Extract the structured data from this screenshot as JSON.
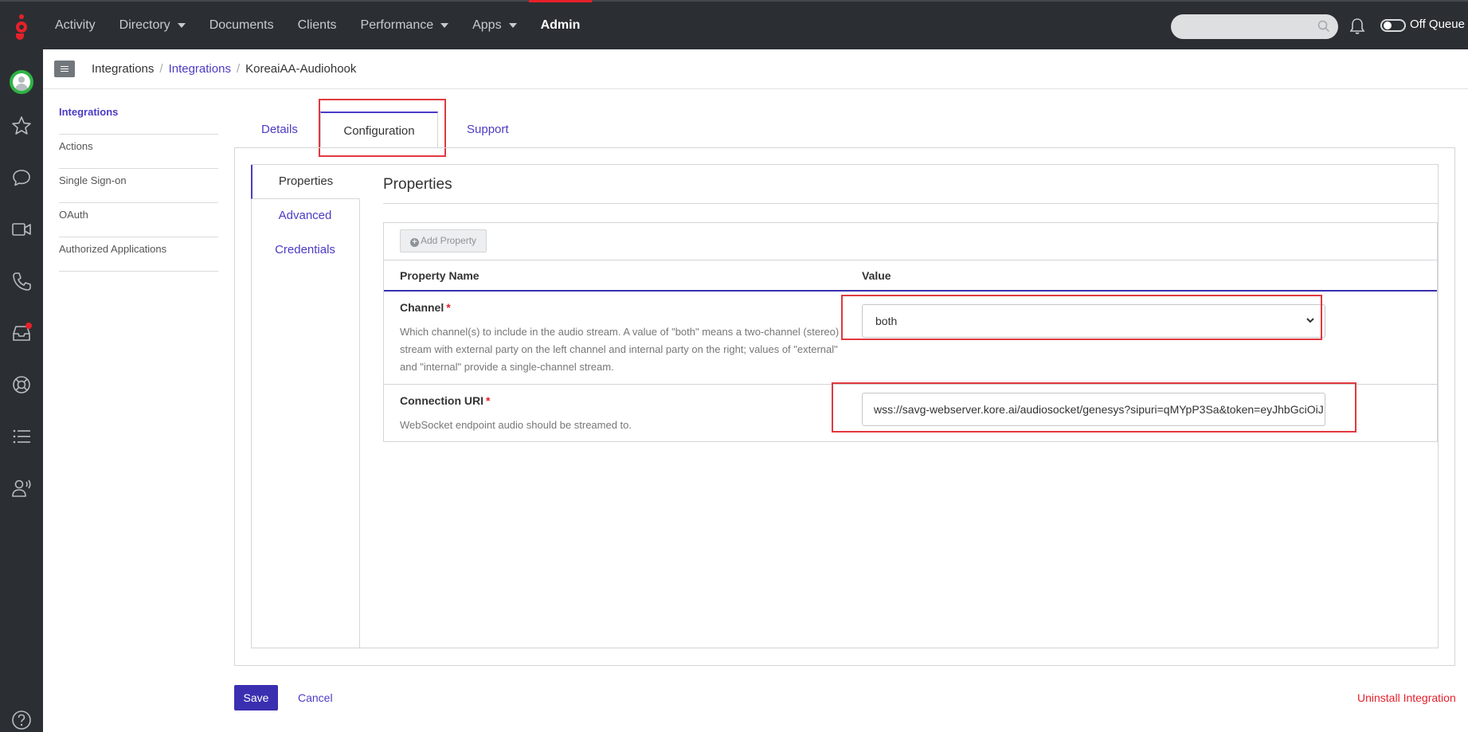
{
  "topnav": {
    "items": [
      {
        "label": "Activity"
      },
      {
        "label": "Directory"
      },
      {
        "label": "Documents"
      },
      {
        "label": "Clients"
      },
      {
        "label": "Performance"
      },
      {
        "label": "Apps"
      },
      {
        "label": "Admin"
      }
    ],
    "queue_status": "Off Queue"
  },
  "breadcrumb": {
    "items": [
      "Integrations",
      "Integrations",
      "KoreaiAA-Audiohook"
    ]
  },
  "sidemenu": {
    "items": [
      "Integrations",
      "Actions",
      "Single Sign-on",
      "OAuth",
      "Authorized Applications"
    ]
  },
  "tabs": {
    "details": "Details",
    "configuration": "Configuration",
    "support": "Support"
  },
  "config": {
    "vtabs": [
      "Properties",
      "Advanced",
      "Credentials"
    ],
    "title": "Properties",
    "add_property": "Add Property",
    "columns": {
      "name": "Property Name",
      "value": "Value"
    },
    "properties": [
      {
        "name": "Channel",
        "required_mark": "*",
        "description": "Which channel(s) to include in the audio stream. A value of \"both\" means a two-channel (stereo) stream with external party on the left channel and internal party on the right; values of \"external\" and \"internal\" provide a single-channel stream.",
        "value": "both"
      },
      {
        "name": "Connection URI",
        "required_mark": "*",
        "description": "WebSocket endpoint audio should be streamed to.",
        "value": "wss://savg-webserver.kore.ai/audiosocket/genesys?sipuri=qMYpP3Sa&token=eyJhbGciOiJ"
      }
    ]
  },
  "footer": {
    "save": "Save",
    "cancel": "Cancel",
    "uninstall": "Uninstall Integration"
  },
  "colors": {
    "accent": "#4b3bc5",
    "brand_red": "#e8202a",
    "highlight": "#e0393e",
    "topbar_bg": "#2b2f33"
  }
}
